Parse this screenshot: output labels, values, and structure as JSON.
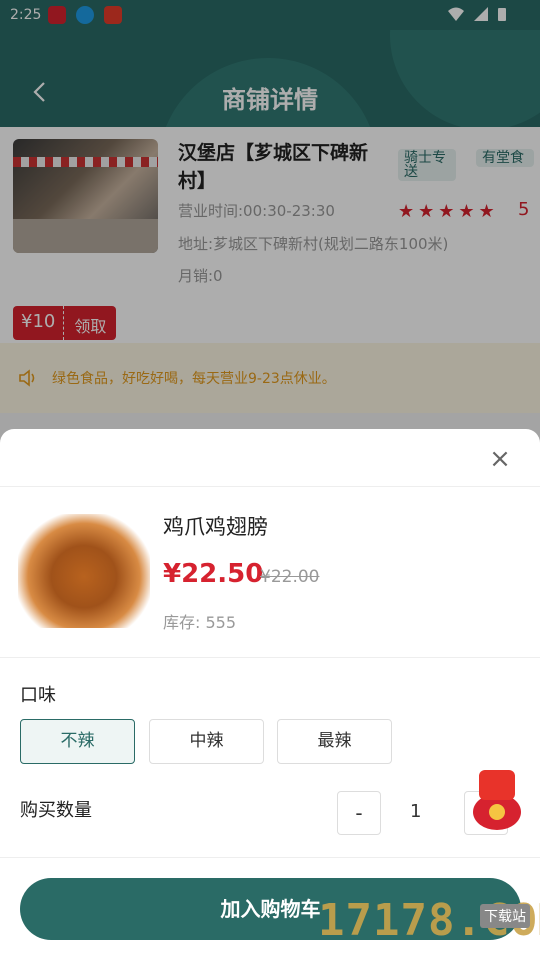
{
  "status_bar": {
    "time": "2:25"
  },
  "header": {
    "title": "商铺详情"
  },
  "shop": {
    "name": "汉堡店【芗城区下碑新村】",
    "tags": [
      "骑士专送",
      "有堂食"
    ],
    "hours": "营业时间:00:30-23:30",
    "address": "地址:芗城区下碑新村(规划二路东100米)",
    "sales": "月销:0",
    "rating_stars": "★★★★★",
    "rating": "5",
    "coupon_amount": "¥10",
    "coupon_action": "领取"
  },
  "notice": {
    "text": "绿色食品，好吃好喝，每天营业9-23点休业。"
  },
  "sheet": {
    "product_name": "鸡爪鸡翅膀",
    "price": "¥22.50",
    "original_price": "¥22.00",
    "stock": "库存: 555",
    "option_label": "口味",
    "options": [
      "不辣",
      "中辣",
      "最辣"
    ],
    "selected_option": "不辣",
    "quantity_label": "购买数量",
    "minus": "-",
    "quantity": "1",
    "plus": "+",
    "close": "×",
    "add_to_cart": "加入购物车"
  },
  "overlays": {
    "red_packet": "红包大派送",
    "watermark": "17178.COM",
    "watermark_tag": "下载站"
  },
  "colors": {
    "primary": "#2a6b66",
    "accent": "#d6222f",
    "notice": "#e39b1e"
  }
}
